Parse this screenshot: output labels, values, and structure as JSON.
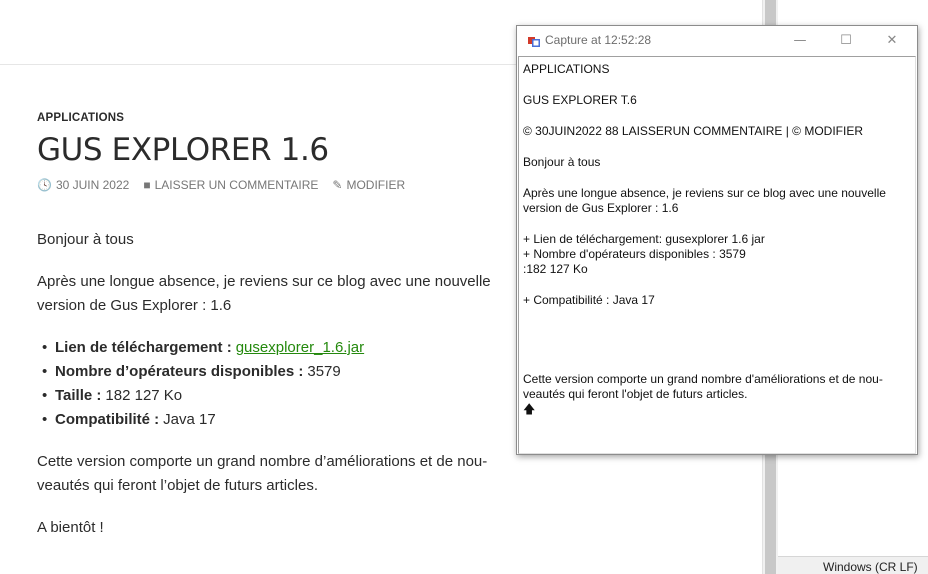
{
  "blog": {
    "category": "APPLICATIONS",
    "title": "GUS EXPLORER 1.6",
    "meta": {
      "date": "30 JUIN 2022",
      "comment": "LAISSER UN COMMENTAIRE",
      "edit": "MODIFIER"
    },
    "greeting": "Bonjour à tous",
    "intro": "Après une longue absence, je reviens sur ce blog avec une nouvelle version de Gus Explorer : 1.6",
    "list": [
      {
        "label": "Lien de téléchargement :",
        "value": "",
        "link": "gusexplorer_1.6.jar"
      },
      {
        "label": "Nombre d’opérateurs disponibles :",
        "value": "3579",
        "link": ""
      },
      {
        "label": "Taille :",
        "value": "182 127 Ko",
        "link": ""
      },
      {
        "label": "Compatibilité :",
        "value": "Java 17",
        "link": ""
      }
    ],
    "body": "Cette version comporte un grand nombre d’améliorations et de nou-veautés qui feront l’objet de futurs articles.",
    "closing": "A bientôt !",
    "link_color": "#24890d"
  },
  "statusbar": {
    "text": "Windows (CR LF)"
  },
  "capture_window": {
    "title": "Capture at 12:52:28",
    "lines": [
      "APPLICATIONS",
      "",
      "GUS EXPLORER T.6",
      "",
      "© 30JUIN2022 88 LAISSERUN COMMENTAIRE | © MODIFIER",
      "",
      "Bonjour à tous",
      "",
      "Après une longue absence, je reviens sur ce blog avec une nouvelle",
      "version de Gus Explorer : 1.6",
      "",
      "+ Lien de téléchargement: gusexplorer 1.6 jar",
      "+ Nombre d'opérateurs disponibles : 3579",
      ":182 127 Ko",
      "",
      "+ Compatibilité : Java 17",
      "",
      "",
      "",
      "",
      "Cette version comporte un grand nombre d'améliorations et de nou-",
      "veautés qui feront l'objet de futurs articles."
    ],
    "last_glyph": "🡅"
  }
}
